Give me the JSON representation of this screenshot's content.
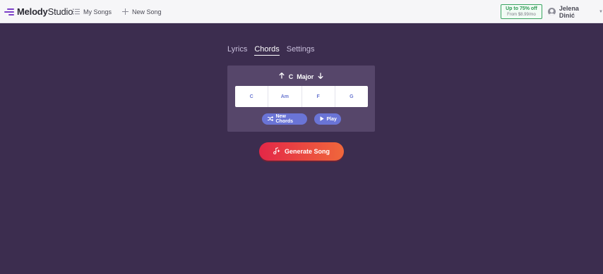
{
  "header": {
    "logo": {
      "bold": "Melody",
      "light": "Studio"
    },
    "nav": [
      {
        "label": "My Songs",
        "icon": "list-icon"
      },
      {
        "label": "New Song",
        "icon": "plus-icon"
      }
    ],
    "promo": {
      "line1": "Up to 75% off",
      "line2": "From $8.99/mo"
    },
    "user": {
      "name": "Jelena Dinić"
    }
  },
  "tabs": [
    {
      "label": "Lyrics",
      "active": false
    },
    {
      "label": "Chords",
      "active": true
    },
    {
      "label": "Settings",
      "active": false
    }
  ],
  "key": {
    "root": "C",
    "mode": "Major"
  },
  "chords": [
    "C",
    "Am",
    "F",
    "G"
  ],
  "actions": {
    "new_chords": "New Chords",
    "play": "Play",
    "generate": "Generate Song"
  },
  "colors": {
    "background": "#3c2d4f",
    "panel": "#56466a",
    "accent": "#6a74d6",
    "generate_start": "#e32747",
    "generate_end": "#f0673b",
    "promo": "#2e9a55"
  }
}
